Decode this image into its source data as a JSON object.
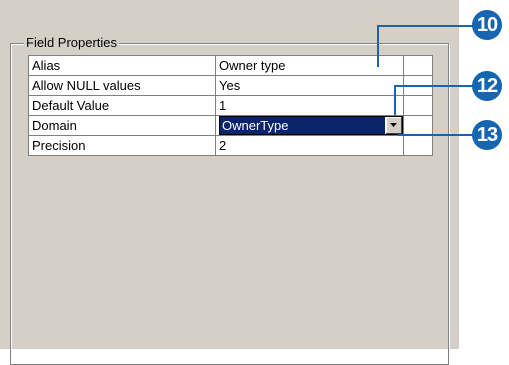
{
  "group_title": "Field Properties",
  "rows": [
    {
      "property": "Alias",
      "value": "Owner type"
    },
    {
      "property": "Allow NULL values",
      "value": "Yes"
    },
    {
      "property": "Default Value",
      "value": "1"
    },
    {
      "property": "Domain",
      "value": "OwnerType"
    },
    {
      "property": "Precision",
      "value": "2"
    }
  ],
  "callouts": [
    "10",
    "12",
    "13"
  ],
  "colors": {
    "callout": "#1565b0",
    "selection": "#0a246a",
    "panel": "#d4d0c8"
  }
}
